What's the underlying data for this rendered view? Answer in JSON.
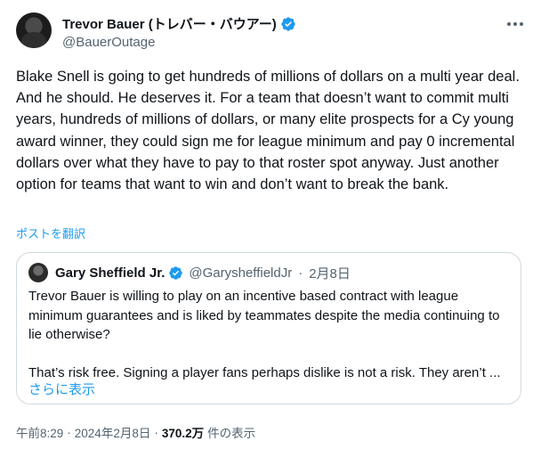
{
  "author": {
    "display_name": "Trevor Bauer (トレバー・バウアー)",
    "handle": "@BauerOutage",
    "verified": true
  },
  "tweet": {
    "text": "Blake Snell is going to get hundreds of millions of dollars on a multi year deal. And he should. He deserves it. For a team that doesn’t want to commit multi years, hundreds of millions of dollars, or many elite prospects for a Cy young award winner, they could sign me for league minimum and pay 0 incremental dollars over what they have to pay to that roster spot anyway. Just another option for teams that want to win and don’t want to break the bank.",
    "translate_label": "ポストを翻訳"
  },
  "quote": {
    "display_name": "Gary Sheffield Jr.",
    "handle": "@GarysheffieldJr",
    "separator": "·",
    "date": "2月8日",
    "text": "Trevor Bauer is willing to play on an incentive based contract with league minimum guarantees and is liked by teammates despite the media continuing to lie otherwise?\n\nThat’s risk free. Signing a player fans perhaps dislike is not a risk. They aren’t ...",
    "show_more_label": "さらに表示"
  },
  "meta": {
    "time": "午前8:29",
    "separator": "·",
    "date": "2024年2月8日",
    "view_count": "370.2万",
    "view_label": "件の表示"
  },
  "colors": {
    "accent": "#1d9bf0",
    "secondary_text": "#536471",
    "border": "#cfd9de"
  }
}
